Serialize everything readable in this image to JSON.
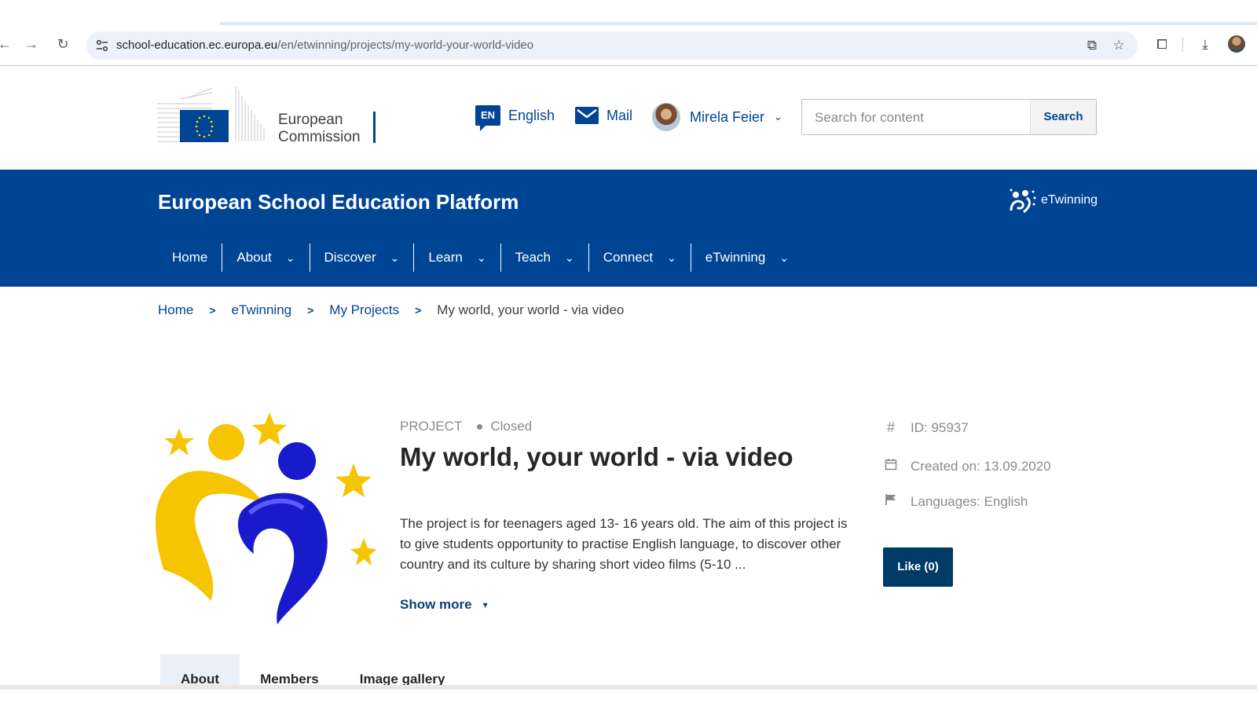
{
  "browser": {
    "url_host": "school-education.ec.europa.eu",
    "url_path": "/en/etwinning/projects/my-world-your-world-video"
  },
  "header": {
    "logo_line1": "European",
    "logo_line2": "Commission",
    "lang_code": "EN",
    "lang_label": "English",
    "mail_label": "Mail",
    "user_name": "Mirela Feier",
    "search_placeholder": "Search for content",
    "search_button": "Search"
  },
  "band": {
    "site_title": "European School Education Platform",
    "etwinning_label": "eTwinning",
    "menu": [
      {
        "label": "Home"
      },
      {
        "label": "About"
      },
      {
        "label": "Discover"
      },
      {
        "label": "Learn"
      },
      {
        "label": "Teach"
      },
      {
        "label": "Connect"
      },
      {
        "label": "eTwinning"
      }
    ]
  },
  "breadcrumb": [
    "Home",
    "eTwinning",
    "My Projects",
    "My world, your world - via video"
  ],
  "project": {
    "type": "PROJECT",
    "status": "Closed",
    "title": "My world, your world - via video",
    "description": "The project is for teenagers aged 13- 16 years old. The aim of this project is to give students opportunity to practise English language, to discover other country and its culture by sharing short video films (5-10 ...",
    "show_more": "Show more",
    "id": "ID: 95937",
    "created": "Created on: 13.09.2020",
    "languages": "Languages: English",
    "like_button": "Like (0)"
  },
  "tabs": [
    "About",
    "Members",
    "Image gallery"
  ]
}
